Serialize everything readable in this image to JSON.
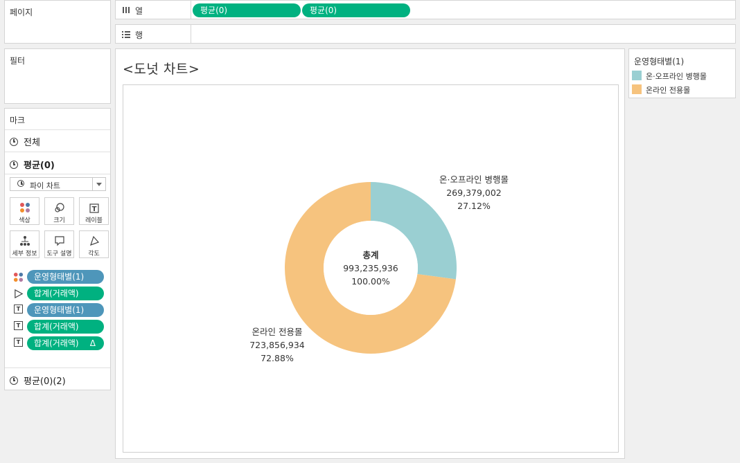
{
  "pages": {
    "label": "페이지"
  },
  "columns_shelf": {
    "label": "열",
    "pills": [
      "평균(0)",
      "평균(0)"
    ]
  },
  "rows_shelf": {
    "label": "행"
  },
  "filters": {
    "label": "필터"
  },
  "marks": {
    "label": "마크",
    "all": "전체",
    "avg": "평균(0)",
    "mark_type": "파이 차트",
    "buttons": [
      "색상",
      "크기",
      "레이블",
      "세부 정보",
      "도구 설명",
      "각도"
    ],
    "pills": [
      {
        "label": "운영형태별(1)",
        "color": "#4e96ba",
        "icon": "color-dots-icon"
      },
      {
        "label": "합계(거래액)",
        "color": "#00b180",
        "icon": "angle-icon"
      },
      {
        "label": "운영형태별(1)",
        "color": "#4e96ba",
        "icon": "text-label-icon"
      },
      {
        "label": "합계(거래액)",
        "color": "#00b180",
        "icon": "text-label-icon"
      },
      {
        "label": "합계(거래액)",
        "color": "#00b180",
        "icon": "text-label-icon",
        "badge": "Δ"
      }
    ],
    "avg2": "평균(0)(2)"
  },
  "legend": {
    "title": "운영형태별(1)",
    "items": [
      {
        "label": "온·오프라인 병행몰",
        "color": "#9acfd2"
      },
      {
        "label": "온라인 전용몰",
        "color": "#f6c37e"
      }
    ]
  },
  "view": {
    "title": "<도넛 차트>"
  },
  "chart_data": {
    "type": "pie",
    "donut": true,
    "center": {
      "label": "총계",
      "value": "993,235,936",
      "percent": "100.00%"
    },
    "slices": [
      {
        "name": "온·오프라인 병행몰",
        "value": 269379002,
        "value_text": "269,379,002",
        "percent": "27.12%",
        "color": "#9acfd2"
      },
      {
        "name": "온라인 전용몰",
        "value": 723856934,
        "value_text": "723,856,934",
        "percent": "72.88%",
        "color": "#f6c37e"
      }
    ]
  }
}
